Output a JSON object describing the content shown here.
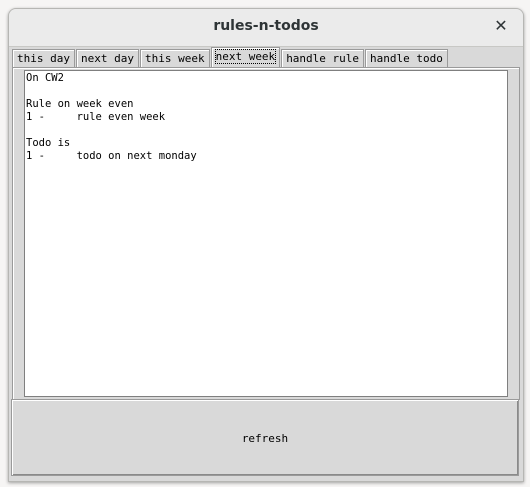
{
  "window": {
    "title": "rules-n-todos",
    "close_glyph": "✕"
  },
  "tabs": [
    {
      "label": "this day",
      "active": false
    },
    {
      "label": "next day",
      "active": false
    },
    {
      "label": "this week",
      "active": false
    },
    {
      "label": "next week",
      "active": true
    },
    {
      "label": "handle rule",
      "active": false
    },
    {
      "label": "handle todo",
      "active": false
    }
  ],
  "content": {
    "text": "On CW2\n\nRule on week even\n1 -     rule even week\n\nTodo is\n1 -     todo on next monday"
  },
  "refresh_button": {
    "label": "refresh"
  }
}
